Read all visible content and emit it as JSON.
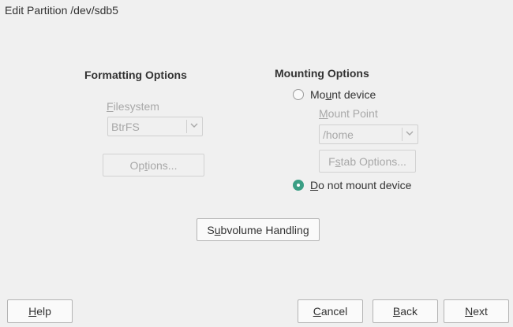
{
  "window": {
    "title": "Edit Partition /dev/sdb5"
  },
  "formatting": {
    "heading": "Formatting Options",
    "filesystem_label_ul": "F",
    "filesystem_label_rest": "ilesystem",
    "filesystem_value": "BtrFS",
    "options_pre": "Op",
    "options_ul": "t",
    "options_post": "ions..."
  },
  "mounting": {
    "heading": "Mounting Options",
    "mount_device_pre": "Mo",
    "mount_device_ul": "u",
    "mount_device_post": "nt device",
    "mount_point_ul": "M",
    "mount_point_rest": "ount Point",
    "mount_point_value": "/home",
    "fstab_pre": "F",
    "fstab_ul": "s",
    "fstab_post": "tab Options...",
    "do_not_mount_ul": "D",
    "do_not_mount_rest": "o not mount device",
    "selected": "do_not_mount"
  },
  "subvolume": {
    "pre": "S",
    "ul": "u",
    "post": "bvolume Handling"
  },
  "footer": {
    "help_ul": "H",
    "help_rest": "elp",
    "cancel_ul": "C",
    "cancel_rest": "ancel",
    "back_ul": "B",
    "back_rest": "ack",
    "next_ul": "N",
    "next_rest": "ext"
  },
  "colors": {
    "accent": "#3a9e84",
    "background": "#f0f0f0",
    "disabled_text": "#a8a8a8"
  },
  "icons": {
    "combo_arrow": "chevron-down-icon"
  }
}
